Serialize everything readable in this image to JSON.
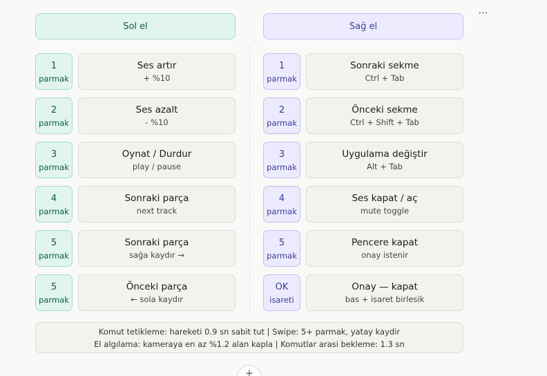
{
  "menu": {
    "more_icon": "⋯"
  },
  "headers": {
    "left": "Sol el",
    "right": "Sağ el"
  },
  "left_hand": [
    {
      "num": "1",
      "unit": "parmak",
      "title": "Ses artır",
      "sub": "+ %10"
    },
    {
      "num": "2",
      "unit": "parmak",
      "title": "Ses azalt",
      "sub": "- %10"
    },
    {
      "num": "3",
      "unit": "parmak",
      "title": "Oynat / Durdur",
      "sub": "play / pause"
    },
    {
      "num": "4",
      "unit": "parmak",
      "title": "Sonraki parça",
      "sub": "next track"
    },
    {
      "num": "5",
      "unit": "parmak",
      "title": "Sonraki parça",
      "sub": "sağa kaydır →"
    },
    {
      "num": "5",
      "unit": "parmak",
      "title": "Önceki parça",
      "sub": "← sola kaydır"
    }
  ],
  "right_hand": [
    {
      "num": "1",
      "unit": "parmak",
      "title": "Sonraki sekme",
      "sub": "Ctrl + Tab"
    },
    {
      "num": "2",
      "unit": "parmak",
      "title": "Önceki sekme",
      "sub": "Ctrl + Shift + Tab"
    },
    {
      "num": "3",
      "unit": "parmak",
      "title": "Uygulama değiştir",
      "sub": "Alt + Tab"
    },
    {
      "num": "4",
      "unit": "parmak",
      "title": "Ses kapat / aç",
      "sub": "mute toggle"
    },
    {
      "num": "5",
      "unit": "parmak",
      "title": "Pencere kapat",
      "sub": "onay istenir"
    },
    {
      "num": "OK",
      "unit": "isareti",
      "title": "Onay — kapat",
      "sub": "bas + isaret birlesik"
    }
  ],
  "footer": {
    "line1": "Komut tetikleme: hareketi 0.9 sn sabit tut | Swipe: 5+ parmak, yatay kaydir",
    "line2": "El algılama: kameraya en az %1.2 alan kapla | Komutlar arasi bekleme: 1.3 sn"
  },
  "add_button": {
    "icon": "+"
  }
}
